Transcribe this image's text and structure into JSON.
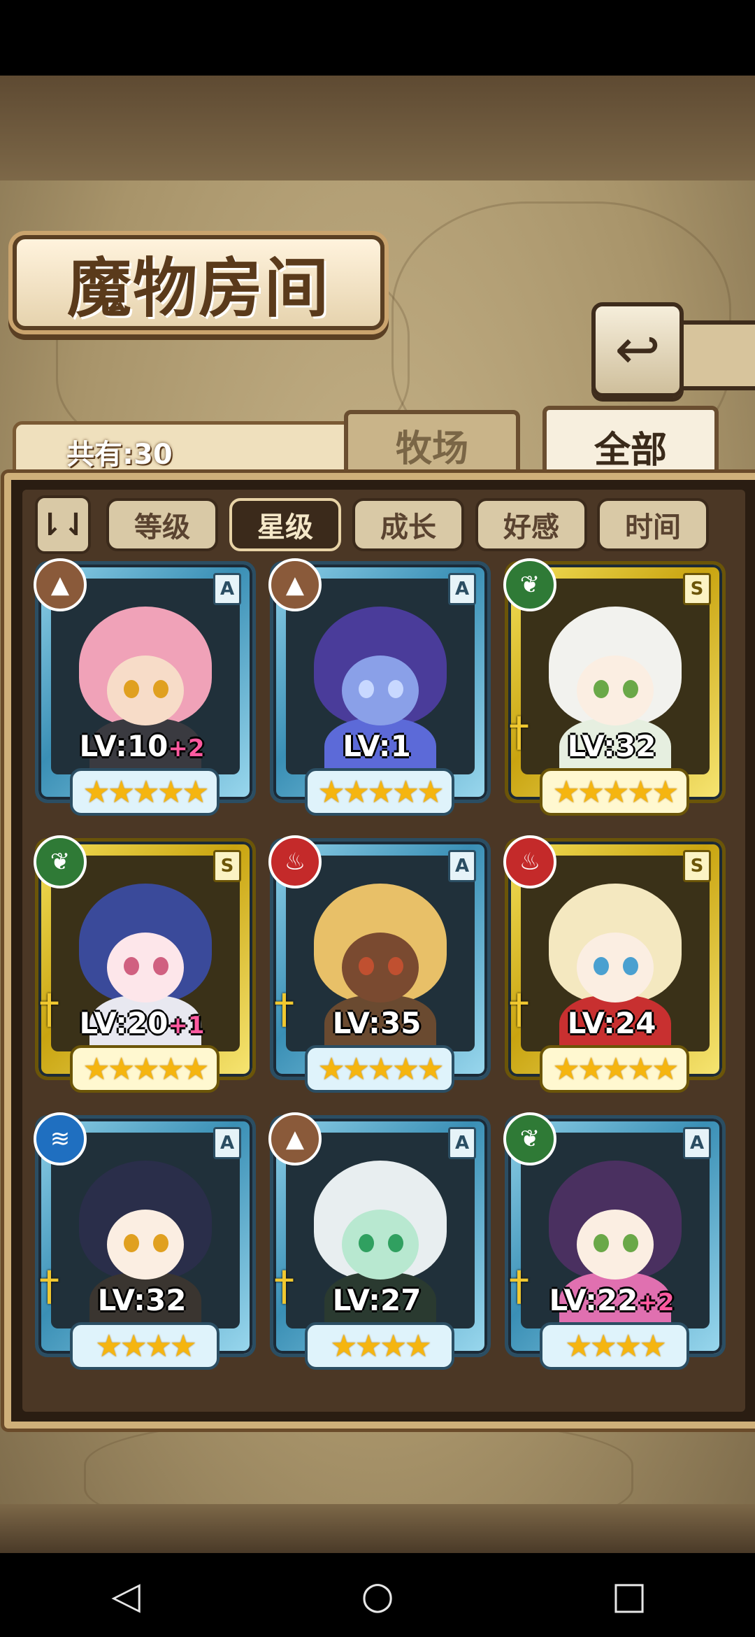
{
  "header": {
    "title": "魔物房间",
    "back_icon": "↩",
    "count_label": "共有:30"
  },
  "tabs": [
    {
      "label": "牧场",
      "active": false
    },
    {
      "label": "全部",
      "active": true
    }
  ],
  "sort": {
    "toggle_label": "⇂⇃",
    "buttons": [
      {
        "label": "等级",
        "active": false
      },
      {
        "label": "星级",
        "active": true
      },
      {
        "label": "成长",
        "active": false
      },
      {
        "label": "好感",
        "active": false
      },
      {
        "label": "时间",
        "active": false
      }
    ]
  },
  "monsters": [
    {
      "rank": "A",
      "element": "earth",
      "element_glyph": "▲",
      "element_color": "#8a5a3a",
      "lv": "LV:10",
      "plus": "+2",
      "stars": "★★★★★",
      "weapon": "",
      "hair": "#f0a2b8",
      "skin": "#f7dcc8",
      "eye": "#e0a020",
      "body": "#3a3a40"
    },
    {
      "rank": "A",
      "element": "earth",
      "element_glyph": "▲",
      "element_color": "#8a5a3a",
      "lv": "LV:1",
      "plus": "",
      "stars": "★★★★★",
      "weapon": "",
      "hair": "#4a3c9a",
      "skin": "#8aa0e8",
      "eye": "#c8d8ff",
      "body": "#5c6ad8"
    },
    {
      "rank": "S",
      "element": "wind",
      "element_glyph": "❦",
      "element_color": "#2f7a36",
      "lv": "LV:32",
      "plus": "",
      "stars": "★★★★★",
      "weapon": "†",
      "hair": "#f2f2ee",
      "skin": "#fbeee2",
      "eye": "#6aa848",
      "body": "#e6efe0"
    },
    {
      "rank": "S",
      "element": "wind",
      "element_glyph": "❦",
      "element_color": "#2f7a36",
      "lv": "LV:20",
      "plus": "+1",
      "stars": "★★★★★",
      "weapon": "†",
      "hair": "#3a4a9a",
      "skin": "#fde6ea",
      "eye": "#d06080",
      "body": "#e8e8f0"
    },
    {
      "rank": "A",
      "element": "fire",
      "element_glyph": "♨",
      "element_color": "#c42a2a",
      "lv": "LV:35",
      "plus": "",
      "stars": "★★★★★",
      "weapon": "†",
      "hair": "#e8c068",
      "skin": "#7a4a30",
      "eye": "#c05030",
      "body": "#6a4a30"
    },
    {
      "rank": "S",
      "element": "fire",
      "element_glyph": "♨",
      "element_color": "#c42a2a",
      "lv": "LV:24",
      "plus": "",
      "stars": "★★★★★",
      "weapon": "†",
      "hair": "#f4e8c0",
      "skin": "#fbeee2",
      "eye": "#4aa0d0",
      "body": "#c83030"
    },
    {
      "rank": "A",
      "element": "water",
      "element_glyph": "≋",
      "element_color": "#1f6fc0",
      "lv": "LV:32",
      "plus": "",
      "stars": "★★★★",
      "weapon": "†",
      "hair": "#2a2e4a",
      "skin": "#fbeee2",
      "eye": "#e0a020",
      "body": "#3a3530"
    },
    {
      "rank": "A",
      "element": "earth",
      "element_glyph": "▲",
      "element_color": "#8a5a3a",
      "lv": "LV:27",
      "plus": "",
      "stars": "★★★★",
      "weapon": "†",
      "hair": "#e8eef0",
      "skin": "#b8e8d0",
      "eye": "#30a060",
      "body": "#2a3a30"
    },
    {
      "rank": "A",
      "element": "wind",
      "element_glyph": "❦",
      "element_color": "#2f7a36",
      "lv": "LV:22",
      "plus": "+2",
      "stars": "★★★★",
      "weapon": "†",
      "hair": "#4a3060",
      "skin": "#fbeee2",
      "eye": "#6aa848",
      "body": "#e070b0"
    }
  ],
  "navbar": {
    "back": "◁",
    "home": "○",
    "recent": "□"
  }
}
